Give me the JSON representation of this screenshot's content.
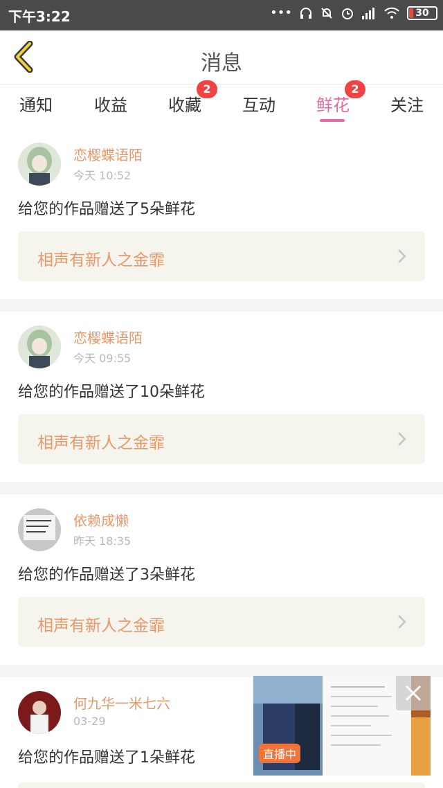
{
  "status_bar": {
    "time": "下午3:22",
    "battery": "30"
  },
  "nav": {
    "title": "消息"
  },
  "tabs": [
    {
      "label": "通知",
      "badge": ""
    },
    {
      "label": "收益",
      "badge": ""
    },
    {
      "label": "收藏",
      "badge": "2"
    },
    {
      "label": "互动",
      "badge": ""
    },
    {
      "label": "鲜花",
      "badge": "2",
      "active": true
    },
    {
      "label": "关注",
      "badge": ""
    }
  ],
  "messages": [
    {
      "sender": "恋樱蝶语陌",
      "time": "今天 10:52",
      "text": "给您的作品赠送了5朵鲜花",
      "work": "相声有新人之金霏"
    },
    {
      "sender": "恋樱蝶语陌",
      "time": "今天 09:55",
      "text": "给您的作品赠送了10朵鲜花",
      "work": "相声有新人之金霏"
    },
    {
      "sender": "依赖成懒",
      "time": "昨天 18:35",
      "text": "给您的作品赠送了3朵鲜花",
      "work": "相声有新人之金霏"
    },
    {
      "sender": "何九华一米七六",
      "time": "03-29",
      "text": "给您的作品赠送了1朵鲜花",
      "work": ""
    }
  ],
  "live_overlay": {
    "badge": "直播中"
  },
  "colors": {
    "accent": "#e96aa0",
    "name": "#e8986a",
    "badge": "#f04444"
  }
}
